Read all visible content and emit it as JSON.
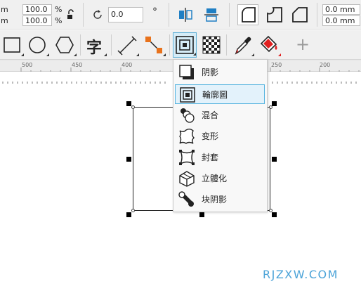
{
  "property_bar": {
    "unit_stub_1": "m",
    "unit_stub_2": "m",
    "scale_x": "100.0",
    "scale_y": "100.0",
    "percent_sign": "%",
    "rotation": "0.0",
    "degree_sign": "°",
    "corner_1": "0.0 mm",
    "corner_2": "0.0 mm"
  },
  "toolbox": {
    "text_tool_glyph": "字",
    "add_label": "+"
  },
  "ruler": {
    "labels": [
      "500",
      "450",
      "400",
      "250",
      "200"
    ]
  },
  "flyout": {
    "items": [
      {
        "label": "阴影",
        "icon": "drop-shadow-icon"
      },
      {
        "label": "輪廓圖",
        "icon": "contour-icon"
      },
      {
        "label": "混合",
        "icon": "blend-icon"
      },
      {
        "label": "变形",
        "icon": "distort-icon"
      },
      {
        "label": "封套",
        "icon": "envelope-icon"
      },
      {
        "label": "立體化",
        "icon": "extrude-icon"
      },
      {
        "label": "块阴影",
        "icon": "block-shadow-icon"
      }
    ],
    "selected_index": 1
  },
  "watermark": "RJZXW.COM",
  "colors": {
    "accent": "#5aaed6",
    "selection_bg": "#e3f2fb",
    "watermark": "#4ba3d8",
    "node_orange": "#e8721c",
    "fill_red": "#e02020"
  }
}
